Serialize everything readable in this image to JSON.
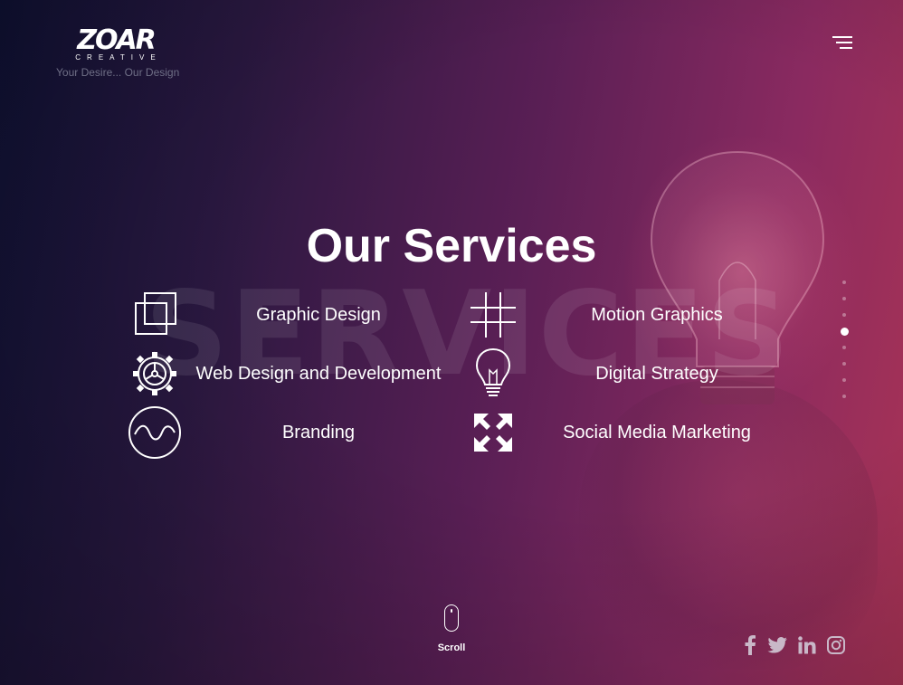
{
  "brand": {
    "logo_text": "ZOAR",
    "logo_subtext": "CREATIVE",
    "tagline": "Your Desire... Our Design"
  },
  "header": {
    "menu_icon": "hamburger-menu-icon"
  },
  "section": {
    "title": "Our Services",
    "watermark": "SERVICES"
  },
  "services": [
    {
      "label": "Graphic Design",
      "icon": "layered-squares-icon"
    },
    {
      "label": "Motion Graphics",
      "icon": "grid-hash-icon"
    },
    {
      "label": "Web Design and Development",
      "icon": "gear-icon"
    },
    {
      "label": "Digital Strategy",
      "icon": "lightbulb-icon"
    },
    {
      "label": "Branding",
      "icon": "wave-circle-icon"
    },
    {
      "label": "Social Media Marketing",
      "icon": "expand-arrows-icon"
    }
  ],
  "pagination": {
    "count": 8,
    "active_index": 3
  },
  "scroll": {
    "label": "Scroll",
    "icon": "mouse-scroll-icon"
  },
  "social": [
    {
      "name": "facebook",
      "icon": "facebook-icon"
    },
    {
      "name": "twitter",
      "icon": "twitter-icon"
    },
    {
      "name": "linkedin",
      "icon": "linkedin-icon"
    },
    {
      "name": "instagram",
      "icon": "instagram-icon"
    }
  ],
  "colors": {
    "gradient_start": "#0f1133",
    "gradient_mid": "#5a1f55",
    "gradient_end": "#a93355",
    "text": "#ffffff",
    "tagline": "#6f6f86",
    "social_icon": "#c9b8c8"
  }
}
